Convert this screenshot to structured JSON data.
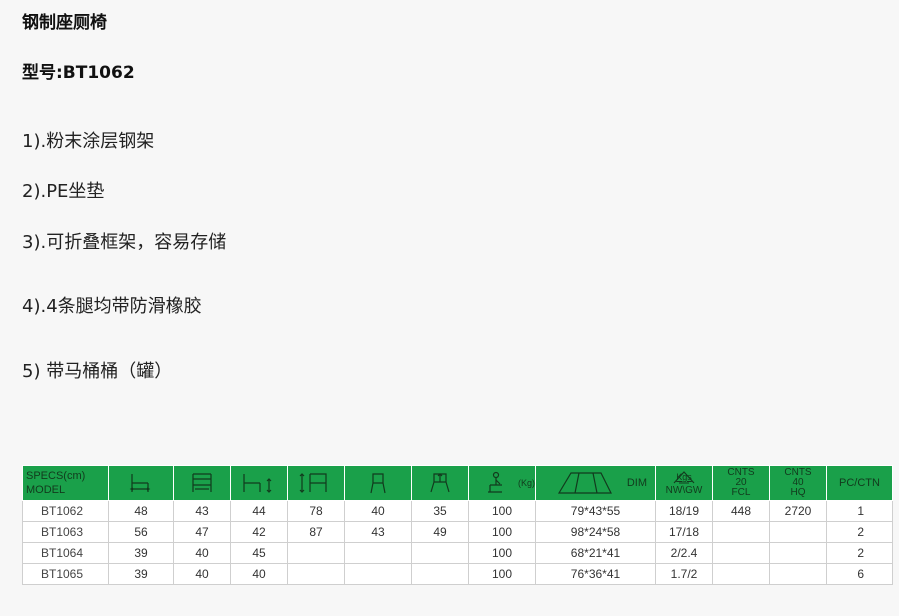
{
  "product": {
    "name": "钢制座厕椅",
    "model_line": "型号:BT1062"
  },
  "features": [
    "1).粉末涂层钢架",
    "2).PE坐垫",
    "3).可折叠框架，容易存储",
    "4).4条腿均带防滑橡胶",
    "5) 带马桶桶（罐）"
  ],
  "table": {
    "header": {
      "specs_label": "SPECS(cm)",
      "model_label": "MODEL",
      "load_unit": "(Kg)",
      "dim_label": "DIM",
      "weight_top": "Kgs",
      "weight_bottom": "NW\\GW",
      "cnts20": [
        "CNTS",
        "20",
        "FCL"
      ],
      "cnts40": [
        "CNTS",
        "40",
        "HQ"
      ],
      "pcctn": "PC/CTN"
    },
    "rows": [
      {
        "model": "BT1062",
        "c1": "48",
        "c2": "43",
        "c3": "44",
        "c4": "78",
        "c5": "40",
        "c6": "35",
        "load": "100",
        "dim": "79*43*55",
        "weight": "18/19",
        "fcl": "448",
        "hq": "2720",
        "pc": "1"
      },
      {
        "model": "BT1063",
        "c1": "56",
        "c2": "47",
        "c3": "42",
        "c4": "87",
        "c5": "43",
        "c6": "49",
        "load": "100",
        "dim": "98*24*58",
        "weight": "17/18",
        "fcl": "",
        "hq": "",
        "pc": "2"
      },
      {
        "model": "BT1064",
        "c1": "39",
        "c2": "40",
        "c3": "45",
        "c4": "",
        "c5": "",
        "c6": "",
        "load": "100",
        "dim": "68*21*41",
        "weight": "2/2.4",
        "fcl": "",
        "hq": "",
        "pc": "2"
      },
      {
        "model": "BT1065",
        "c1": "39",
        "c2": "40",
        "c3": "40",
        "c4": "",
        "c5": "",
        "c6": "",
        "load": "100",
        "dim": "76*36*41",
        "weight": "1.7/2",
        "fcl": "",
        "hq": "",
        "pc": "6"
      }
    ],
    "colors": {
      "header_green": "#1aa04a",
      "header_text": "#123a1d"
    },
    "icons": [
      "chair-depth-icon",
      "chair-width-icon",
      "seat-height-icon",
      "overall-height-icon",
      "chair-front-icon",
      "chair-side-icon",
      "load-capacity-icon",
      "carton-dim-icon",
      "weight-scale-icon"
    ]
  }
}
